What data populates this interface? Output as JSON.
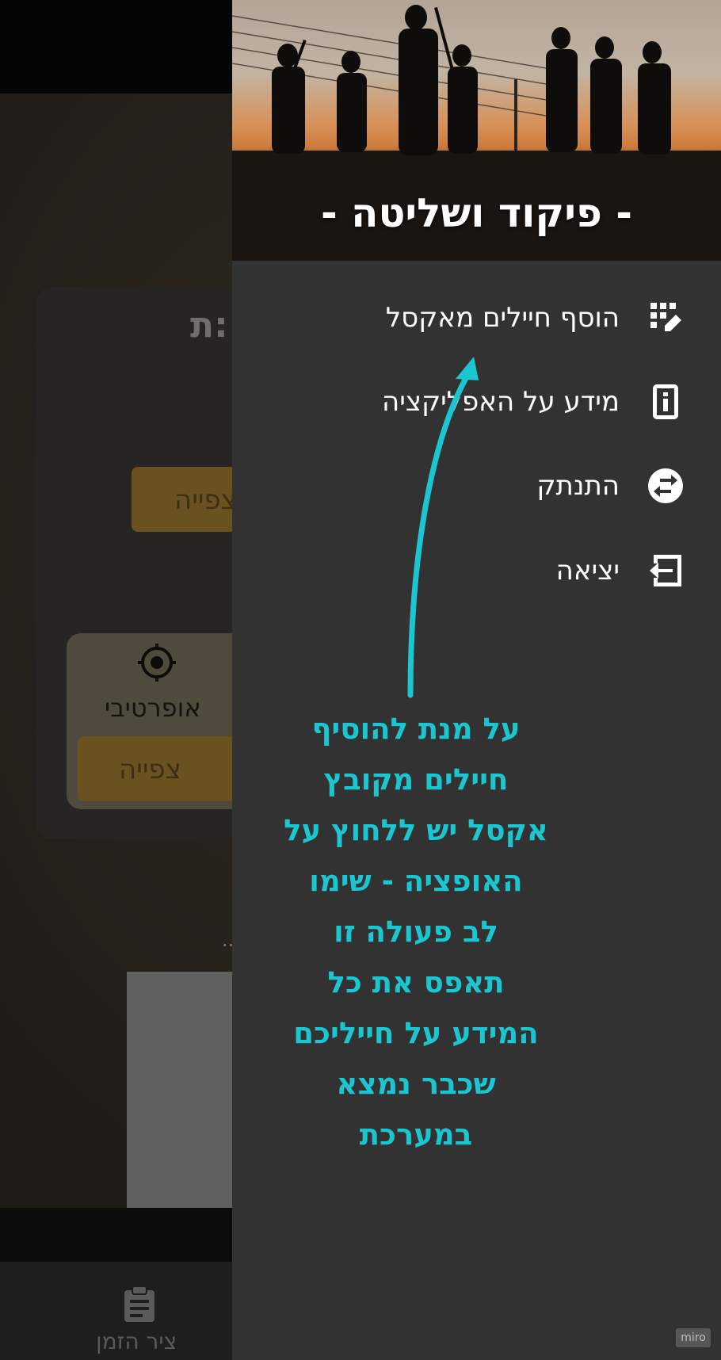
{
  "drawer": {
    "title": "- פיקוד ושליטה -",
    "items": [
      {
        "label": "הוסף חיילים מאקסל",
        "icon": "excel-grid-edit-icon"
      },
      {
        "label": "מידע על האפליקציה",
        "icon": "info-icon"
      },
      {
        "label": "התנתק",
        "icon": "swap-arrows-icon"
      },
      {
        "label": "יציאה",
        "icon": "exit-icon"
      }
    ]
  },
  "annotation": {
    "lines": [
      "על מנת להוסיף",
      "חיילים מקובץ",
      "אקסל יש ללחוץ על",
      "האופציה - שימו",
      "לב פעולה זו",
      "תאפס את כל",
      "המידע על חייליכם",
      "שכבר נמצא",
      "במערכת"
    ]
  },
  "background": {
    "card_title_partial": "ת:",
    "watch_button_partial": "צפייה",
    "tile_label": "אופרטיבי",
    "tile_button": "צפייה",
    "dots": "..",
    "bottom_nav_label": "ציר הזמן"
  },
  "badge": "miro",
  "colors": {
    "annotation": "#1cc6d1",
    "drawer_bg": "#323232",
    "accent_gold": "#6a5120"
  }
}
